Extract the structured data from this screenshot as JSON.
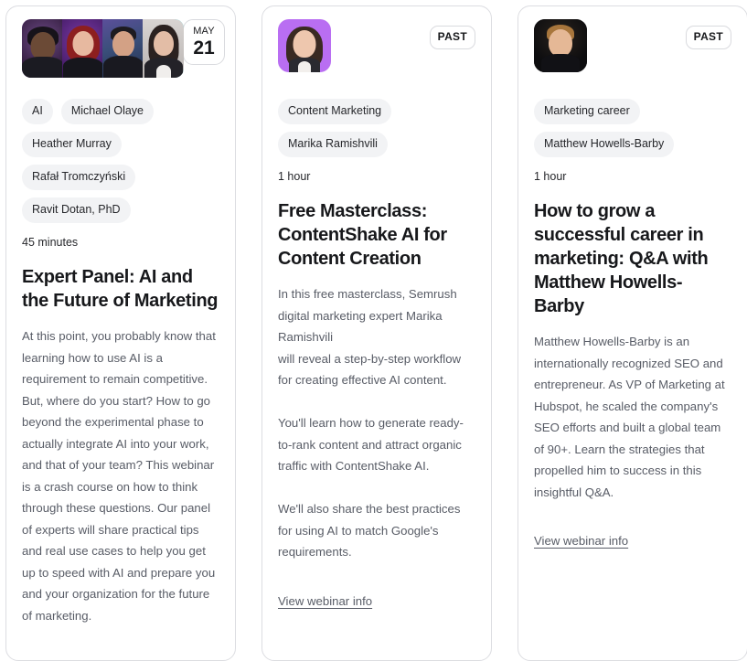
{
  "colors": {
    "card_border": "#dcdde1",
    "tag_bg": "#f2f3f5",
    "title_text": "#17181b",
    "body_text": "#585c66",
    "avatar_purple": "#b46bf0",
    "avatar_cyan": "#3fd8ea",
    "avatar_lilac": "#b96ef2",
    "avatar_dark": "#0c0c0e"
  },
  "cards": [
    {
      "id": "expert-panel-ai-future-marketing",
      "badge": {
        "type": "date",
        "month": "MAY",
        "day": "21"
      },
      "avatars": [
        {
          "name": "michael-olaye-avatar",
          "bg": "#b46bf0"
        },
        {
          "name": "heather-murray-avatar",
          "bg": "#3fd8ea"
        },
        {
          "name": "rafal-tromczynski-avatar",
          "bg": "#a95ff0"
        },
        {
          "name": "ravit-dotan-avatar",
          "bg": "#3fd8ea"
        }
      ],
      "tags": [
        "AI",
        "Michael Olaye",
        "Heather Murray",
        "Rafał Tromczyński",
        "Ravit Dotan, PhD"
      ],
      "duration": "45 minutes",
      "title": "Expert Panel: AI and the Future of Marketing",
      "description": "At this point, you probably know that learning how to use AI is a requirement to remain competitive. But, where do you start? How to go beyond the experimental phase to actually integrate AI into your work, and that of your team? This webinar is a crash course on how to think through these questions. Our panel of experts will share practical tips and real use cases to help you get up to speed with AI and prepare you and your organization for the future of marketing.",
      "link_label": ""
    },
    {
      "id": "free-masterclass-contentshake-ai",
      "badge": {
        "type": "past",
        "label": "PAST"
      },
      "avatars": [
        {
          "name": "marika-ramishvili-avatar",
          "bg": "#b96ef2"
        }
      ],
      "tags": [
        "Content Marketing",
        "Marika Ramishvili"
      ],
      "duration": "1 hour",
      "title": "Free Masterclass: ContentShake AI for Content Creation",
      "description": "In this free masterclass, Semrush digital marketing expert Marika Ramishvili\nwill reveal a step-by-step workflow for creating effective AI content.\n\nYou'll learn how to generate ready-to-rank content and attract organic traffic with ContentShake AI.\n\nWe'll also share the best practices for using AI to match Google's requirements.",
      "link_label": "View webinar info"
    },
    {
      "id": "how-to-grow-successful-career-marketing",
      "badge": {
        "type": "past",
        "label": "PAST"
      },
      "avatars": [
        {
          "name": "matthew-howells-barby-avatar",
          "bg": "#0c0c0e"
        }
      ],
      "tags": [
        "Marketing career",
        "Matthew Howells-Barby"
      ],
      "duration": "1 hour",
      "title": "How to grow a successful career in marketing: Q&A with Matthew Howells-Barby",
      "description": "Matthew Howells-Barby is an internationally recognized SEO and entrepreneur. As VP of Marketing at Hubspot, he scaled the company's SEO efforts and built a global team of 90+. Learn the strategies that propelled him to success in this insightful Q&A.",
      "link_label": "View webinar info"
    }
  ]
}
